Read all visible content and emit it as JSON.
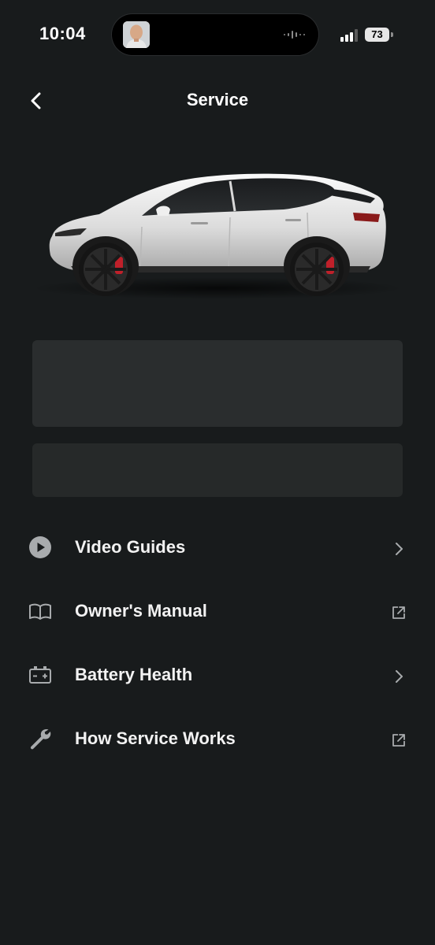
{
  "status_bar": {
    "time": "10:04",
    "battery_level": "73",
    "icons": [
      "contact-avatar",
      "audio-waveform-icon",
      "cellular-signal-icon",
      "battery-icon"
    ]
  },
  "nav": {
    "title": "Service",
    "back_icon": "chevron-left-icon"
  },
  "vehicle": {
    "image": "white-suv-side-view",
    "color": "#e6e6e6",
    "caliper_color": "#c0202a"
  },
  "menu": {
    "items": [
      {
        "label": "Video Guides",
        "icon": "play-circle-icon",
        "action_icon": "chevron-right-icon"
      },
      {
        "label": "Owner's Manual",
        "icon": "book-icon",
        "action_icon": "external-link-icon"
      },
      {
        "label": "Battery Health",
        "icon": "battery-icon",
        "action_icon": "chevron-right-icon"
      },
      {
        "label": "How Service Works",
        "icon": "wrench-icon",
        "action_icon": "external-link-icon"
      }
    ]
  },
  "colors": {
    "background": "#181b1c",
    "card": "#2a2d2e",
    "text": "#f2f2f2",
    "icon": "#a8abad"
  }
}
